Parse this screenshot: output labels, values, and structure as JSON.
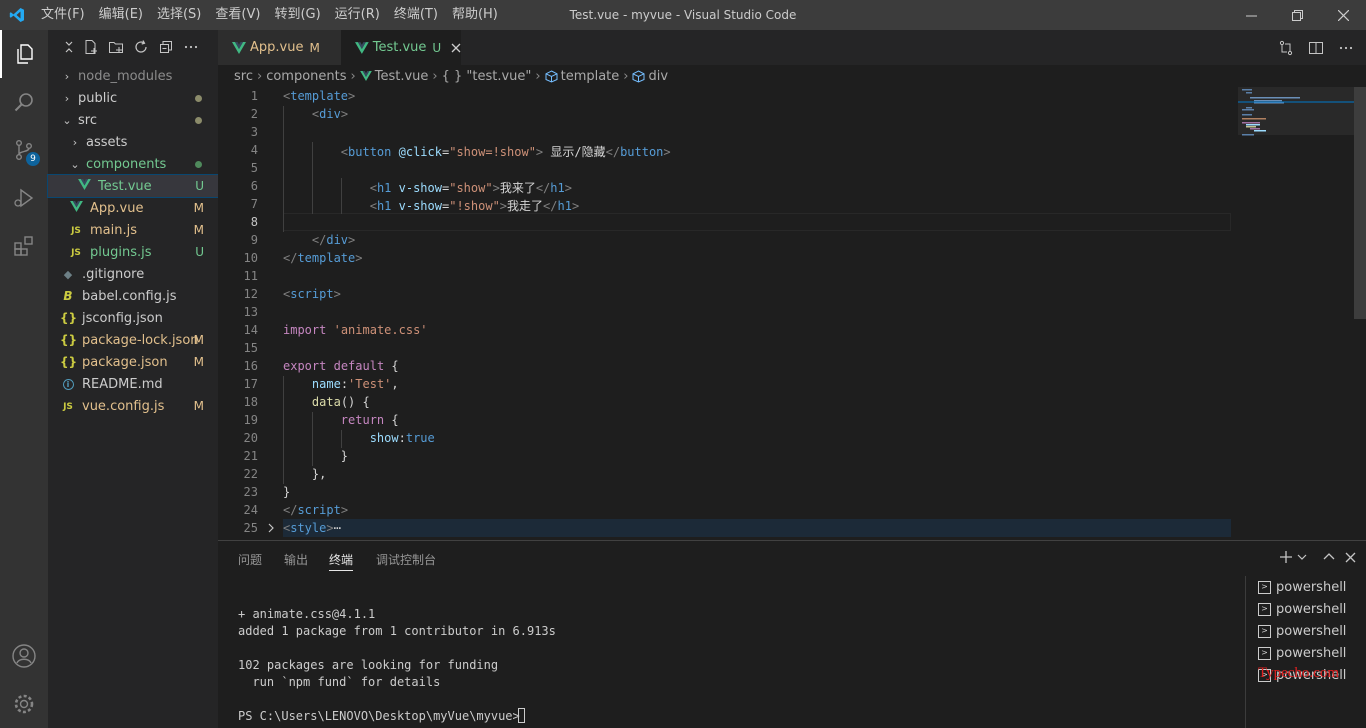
{
  "window": {
    "title": "Test.vue - myvue - Visual Studio Code",
    "menu": [
      "文件(F)",
      "编辑(E)",
      "选择(S)",
      "查看(V)",
      "转到(G)",
      "运行(R)",
      "终端(T)",
      "帮助(H)"
    ]
  },
  "activity_bar": {
    "items": [
      "explorer-icon",
      "search-icon",
      "source-control-icon",
      "run-debug-icon",
      "extensions-icon",
      "account-icon",
      "settings-gear-icon"
    ],
    "source_control_badge": "9"
  },
  "explorer": {
    "items": [
      {
        "label": "node_modules",
        "type": "folder",
        "expanded": false,
        "color": "#8c8c8c"
      },
      {
        "label": "public",
        "type": "folder",
        "expanded": false,
        "dot": "#8b8b6a"
      },
      {
        "label": "src",
        "type": "folder",
        "expanded": true,
        "dot": "#8b8b6a"
      },
      {
        "label": "assets",
        "type": "folder",
        "expanded": false
      },
      {
        "label": "components",
        "type": "folder",
        "expanded": true,
        "color": "#73c991",
        "dot": "#4f8a5c"
      },
      {
        "label": "Test.vue",
        "type": "vue",
        "status": "U",
        "color": "#73c991",
        "selected": true
      },
      {
        "label": "App.vue",
        "type": "vue",
        "status": "M",
        "color": "#e2c08d"
      },
      {
        "label": "main.js",
        "type": "js",
        "status": "M",
        "color": "#e2c08d"
      },
      {
        "label": "plugins.js",
        "type": "js",
        "status": "U",
        "color": "#73c991"
      },
      {
        "label": ".gitignore",
        "type": "git"
      },
      {
        "label": "babel.config.js",
        "type": "babel"
      },
      {
        "label": "jsconfig.json",
        "type": "json"
      },
      {
        "label": "package-lock.json",
        "type": "json",
        "status": "M",
        "color": "#e2c08d"
      },
      {
        "label": "package.json",
        "type": "json",
        "status": "M",
        "color": "#e2c08d"
      },
      {
        "label": "README.md",
        "type": "info"
      },
      {
        "label": "vue.config.js",
        "type": "js",
        "status": "M",
        "color": "#e2c08d"
      }
    ]
  },
  "tabs": [
    {
      "label": "App.vue",
      "status": "M",
      "active": false
    },
    {
      "label": "Test.vue",
      "status": "U",
      "active": true
    }
  ],
  "breadcrumbs": [
    "src",
    "components",
    "Test.vue",
    "{ } \"test.vue\"",
    "template",
    "div"
  ],
  "code_lines": [
    [
      [
        "tg",
        "<"
      ],
      [
        "tn",
        "template"
      ],
      [
        "tg",
        ">"
      ]
    ],
    [
      [
        "tx",
        "    "
      ],
      [
        "tg",
        "<"
      ],
      [
        "tn",
        "div"
      ],
      [
        "tg",
        ">"
      ]
    ],
    [],
    [
      [
        "tx",
        "        "
      ],
      [
        "tg",
        "<"
      ],
      [
        "tn",
        "button"
      ],
      [
        "tx",
        " "
      ],
      [
        "at",
        "@click"
      ],
      [
        "tx",
        "="
      ],
      [
        "st",
        "\"show=!show\""
      ],
      [
        "tg",
        ">"
      ],
      [
        "tx",
        " 显示/隐藏"
      ],
      [
        "tg",
        "</"
      ],
      [
        "tn",
        "button"
      ],
      [
        "tg",
        ">"
      ]
    ],
    [],
    [
      [
        "tx",
        "            "
      ],
      [
        "tg",
        "<"
      ],
      [
        "tn",
        "h1"
      ],
      [
        "tx",
        " "
      ],
      [
        "at",
        "v-show"
      ],
      [
        "tx",
        "="
      ],
      [
        "st",
        "\"show\""
      ],
      [
        "tg",
        ">"
      ],
      [
        "tx",
        "我来了"
      ],
      [
        "tg",
        "</"
      ],
      [
        "tn",
        "h1"
      ],
      [
        "tg",
        ">"
      ]
    ],
    [
      [
        "tx",
        "            "
      ],
      [
        "tg",
        "<"
      ],
      [
        "tn",
        "h1"
      ],
      [
        "tx",
        " "
      ],
      [
        "at",
        "v-show"
      ],
      [
        "tx",
        "="
      ],
      [
        "st",
        "\"!show\""
      ],
      [
        "tg",
        ">"
      ],
      [
        "tx",
        "我走了"
      ],
      [
        "tg",
        "</"
      ],
      [
        "tn",
        "h1"
      ],
      [
        "tg",
        ">"
      ]
    ],
    [],
    [
      [
        "tx",
        "    "
      ],
      [
        "tg",
        "</"
      ],
      [
        "tn",
        "div"
      ],
      [
        "tg",
        ">"
      ]
    ],
    [
      [
        "tg",
        "</"
      ],
      [
        "tn",
        "template"
      ],
      [
        "tg",
        ">"
      ]
    ],
    [],
    [
      [
        "tg",
        "<"
      ],
      [
        "tn",
        "script"
      ],
      [
        "tg",
        ">"
      ]
    ],
    [],
    [
      [
        "kw",
        "import"
      ],
      [
        "tx",
        " "
      ],
      [
        "st",
        "'animate.css'"
      ]
    ],
    [],
    [
      [
        "kw",
        "export"
      ],
      [
        "tx",
        " "
      ],
      [
        "kw",
        "default"
      ],
      [
        "tx",
        " {"
      ]
    ],
    [
      [
        "tx",
        "    "
      ],
      [
        "at",
        "name"
      ],
      [
        "tx",
        ":"
      ],
      [
        "st",
        "'Test'"
      ],
      [
        "tx",
        ","
      ]
    ],
    [
      [
        "tx",
        "    "
      ],
      [
        "fn",
        "data"
      ],
      [
        "tx",
        "() {"
      ]
    ],
    [
      [
        "tx",
        "        "
      ],
      [
        "kw",
        "return"
      ],
      [
        "tx",
        " {"
      ]
    ],
    [
      [
        "tx",
        "            "
      ],
      [
        "at",
        "show"
      ],
      [
        "tx",
        ":"
      ],
      [
        "bo",
        "true"
      ]
    ],
    [
      [
        "tx",
        "        }"
      ]
    ],
    [
      [
        "tx",
        "    },"
      ]
    ],
    [
      [
        "tx",
        "}"
      ]
    ],
    [
      [
        "tg",
        "</"
      ],
      [
        "tn",
        "script"
      ],
      [
        "tg",
        ">"
      ]
    ],
    [
      [
        "tg",
        "<"
      ],
      [
        "tn",
        "style"
      ],
      [
        "tg",
        ">"
      ],
      [
        "tx",
        "⋯"
      ]
    ]
  ],
  "panel": {
    "tabs": [
      "问题",
      "输出",
      "终端",
      "调试控制台"
    ],
    "active_tab": "终端",
    "terminal_lines": [
      "+ animate.css@4.1.1",
      "added 1 package from 1 contributor in 6.913s",
      "",
      "102 packages are looking for funding",
      "  run `npm fund` for details",
      "",
      "PS C:\\Users\\LENOVO\\Desktop\\myVue\\myvue> "
    ],
    "shells": [
      "powershell",
      "powershell",
      "powershell",
      "powershell",
      "powershell"
    ]
  },
  "watermark": "Typecho.com",
  "colors": {
    "accent": "#007acc",
    "untracked": "#73c991",
    "modified": "#e2c08d",
    "vue": "#41b883",
    "js": "#cbcb41"
  }
}
